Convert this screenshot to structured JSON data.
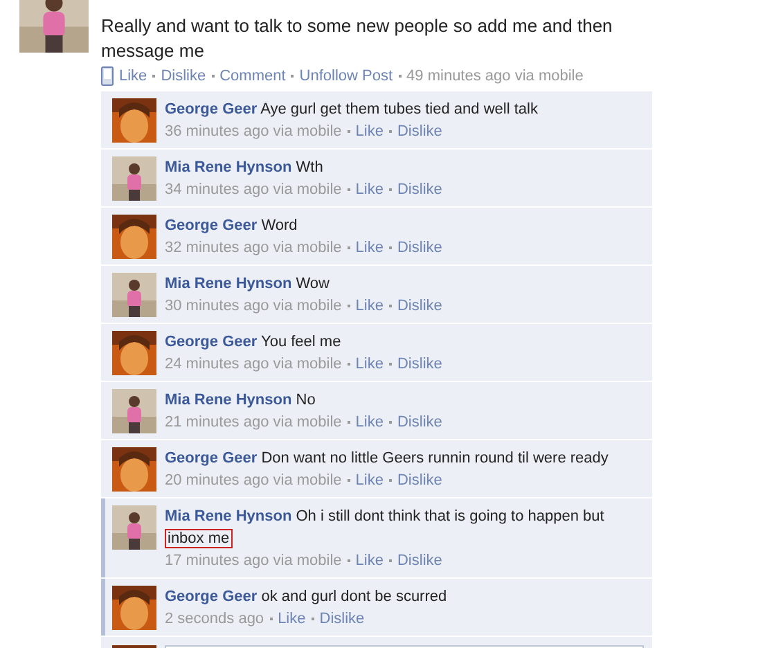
{
  "post": {
    "text": "Really and want to talk to some new people so add me and then message me",
    "actions": [
      "Like",
      "Dislike",
      "Comment",
      "Unfollow Post"
    ],
    "time": "49 minutes ago via mobile"
  },
  "comments": [
    {
      "author": "George Geer",
      "text": "Aye gurl get them tubes tied and well talk",
      "time": "36 minutes ago via mobile",
      "actions": [
        "Like",
        "Dislike"
      ],
      "highlighted": false
    },
    {
      "author": "Mia Rene Hynson",
      "text": "Wth",
      "time": "34 minutes ago via mobile",
      "actions": [
        "Like",
        "Dislike"
      ],
      "highlighted": false
    },
    {
      "author": "George Geer",
      "text": "Word",
      "time": "32 minutes ago via mobile",
      "actions": [
        "Like",
        "Dislike"
      ],
      "highlighted": false
    },
    {
      "author": "Mia Rene Hynson",
      "text": "Wow",
      "time": "30 minutes ago via mobile",
      "actions": [
        "Like",
        "Dislike"
      ],
      "highlighted": false
    },
    {
      "author": "George Geer",
      "text": "You feel me",
      "time": "24 minutes ago via mobile",
      "actions": [
        "Like",
        "Dislike"
      ],
      "highlighted": false
    },
    {
      "author": "Mia Rene Hynson",
      "text": "No",
      "time": "21 minutes ago via mobile",
      "actions": [
        "Like",
        "Dislike"
      ],
      "highlighted": false
    },
    {
      "author": "George Geer",
      "text": "Don want no little Geers runnin round til were ready",
      "time": "20 minutes ago via mobile",
      "actions": [
        "Like",
        "Dislike"
      ],
      "highlighted": false
    },
    {
      "author": "Mia Rene Hynson",
      "text": "Oh i still dont think that is going to happen but",
      "boxed_text": "inbox me",
      "time": "17 minutes ago via mobile",
      "actions": [
        "Like",
        "Dislike"
      ],
      "highlighted": true
    },
    {
      "author": "George Geer",
      "text": "ok and gurl dont be scurred",
      "time": "2 seconds ago",
      "actions": [
        "Like",
        "Dislike"
      ],
      "highlighted": true
    }
  ]
}
